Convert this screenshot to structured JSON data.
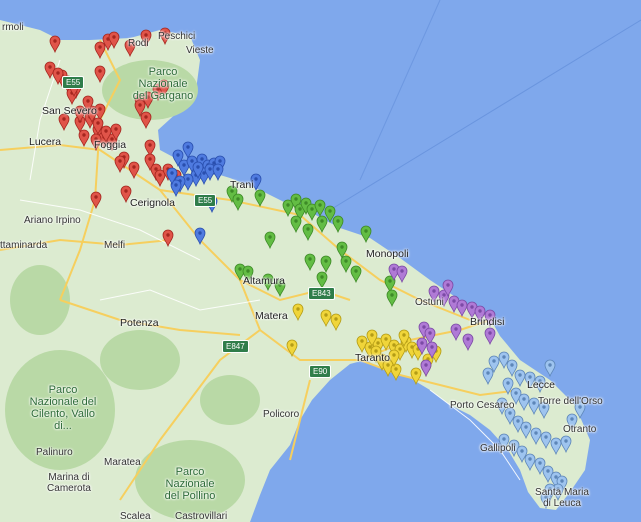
{
  "colors": {
    "sea": "#7fa8ec",
    "land": "#dcebd0",
    "forest": "#b9d9a6",
    "road": "#f6cf5e",
    "pin_red": "#e05449",
    "pin_blue": "#4f7be0",
    "pin_green": "#63bd44",
    "pin_yellow": "#f0d53a",
    "pin_purple": "#b07ad6",
    "pin_lightblue": "#9ec4ef"
  },
  "places": {
    "rodi": "Rodi",
    "peschici": "Peschici",
    "vieste": "Vieste",
    "san_severo": "San Severo",
    "lucera": "Lucera",
    "foggia": "Foggia",
    "trani": "Trani",
    "cerignola": "Cerignola",
    "ariano_irpino": "Ariano Irpino",
    "montaminarda": "ttaminarda",
    "melfi": "Melfi",
    "altamura": "Altamura",
    "monopoli": "Monopoli",
    "ostuni": "Ostuni",
    "brindisi": "Brindisi",
    "potenza": "Potenza",
    "matera": "Matera",
    "taranto": "Taranto",
    "lecce": "Lecce",
    "torre_dellorso": "Torre dell'Orso",
    "porto_cesareo": "Porto Cesareo",
    "otranto": "Otranto",
    "policoro": "Policoro",
    "gallipoli": "Gallipoli",
    "palinuro": "Palinuro",
    "maratea": "Maratea",
    "marina_camerota": "Marina di Camerota",
    "santa_maria_leuca": "Santa Maria di Leuca",
    "scalea": "Scalea",
    "castrovillari": "Castrovillari",
    "rmoli": "rmoli"
  },
  "parks": {
    "gargano": "Parco Nazionale del Gargano",
    "cilento": "Parco Nazionale del Cilento, Vallo di...",
    "pollino": "Parco Nazionale del Pollino"
  },
  "roads": {
    "e55_north": "E55",
    "e55_south": "E55",
    "e843": "E843",
    "e847": "E847",
    "e90": "E90"
  },
  "pin_groups": [
    {
      "color": "red",
      "count": 48
    },
    {
      "color": "blue",
      "count": 20
    },
    {
      "color": "green",
      "count": 28
    },
    {
      "color": "yellow",
      "count": 24
    },
    {
      "color": "purple",
      "count": 18
    },
    {
      "color": "lightblue",
      "count": 34
    }
  ]
}
